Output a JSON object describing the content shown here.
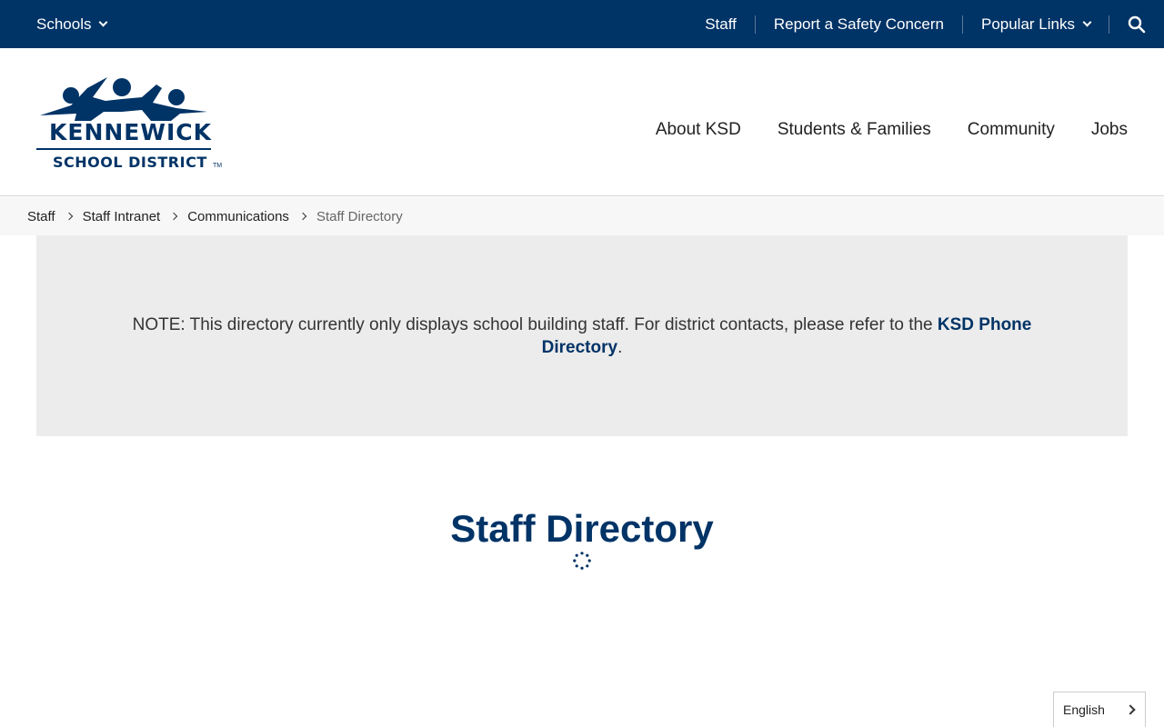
{
  "utility_bar": {
    "schools_label": "Schools",
    "links": [
      "Staff",
      "Report a Safety Concern",
      "Popular Links"
    ],
    "background": "#003366"
  },
  "logo": {
    "name_line1": "KENNEWICK",
    "name_line2": "SCHOOL DISTRICT",
    "trademark": "TM"
  },
  "main_nav": [
    "About KSD",
    "Students & Families",
    "Community",
    "Jobs"
  ],
  "breadcrumb": [
    "Staff",
    "Staff Intranet",
    "Communications",
    "Staff Directory"
  ],
  "note": {
    "text": "NOTE: This directory currently only displays school building staff. For district contacts, please refer to the ",
    "link": "KSD Phone Directory",
    "end": "."
  },
  "page_title": "Staff Directory",
  "language": {
    "selected": "English"
  },
  "icons": [
    "chevron-down-icon",
    "search-icon",
    "loading-spinner-icon",
    "chevron-right-icon"
  ],
  "colors": {
    "brand": "#003366",
    "note_bg": "#ececec",
    "breadcrumb_bg": "#f7f7f7"
  }
}
